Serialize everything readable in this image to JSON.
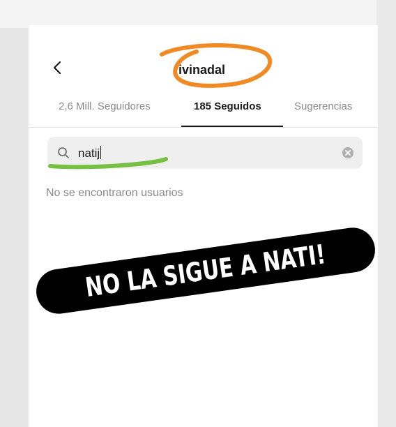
{
  "header": {
    "username": "ivinadal"
  },
  "tabs": [
    {
      "label": "2,6 Mill. Seguidores"
    },
    {
      "label": "185 Seguidos"
    },
    {
      "label": "Sugerencias"
    }
  ],
  "active_tab": "185 Seguidos",
  "search": {
    "value": "natij"
  },
  "empty_state": "No se encontraron usuarios",
  "banner": {
    "text": "NO LA SIGUE A NATI!"
  },
  "colors": {
    "annotation_circle": "#f08a24",
    "annotation_underline": "#76c043",
    "banner_bg": "#000000",
    "banner_text": "#ffffff"
  },
  "icons": {
    "back": "chevron-left-icon",
    "search": "search-icon",
    "clear": "clear-icon"
  }
}
